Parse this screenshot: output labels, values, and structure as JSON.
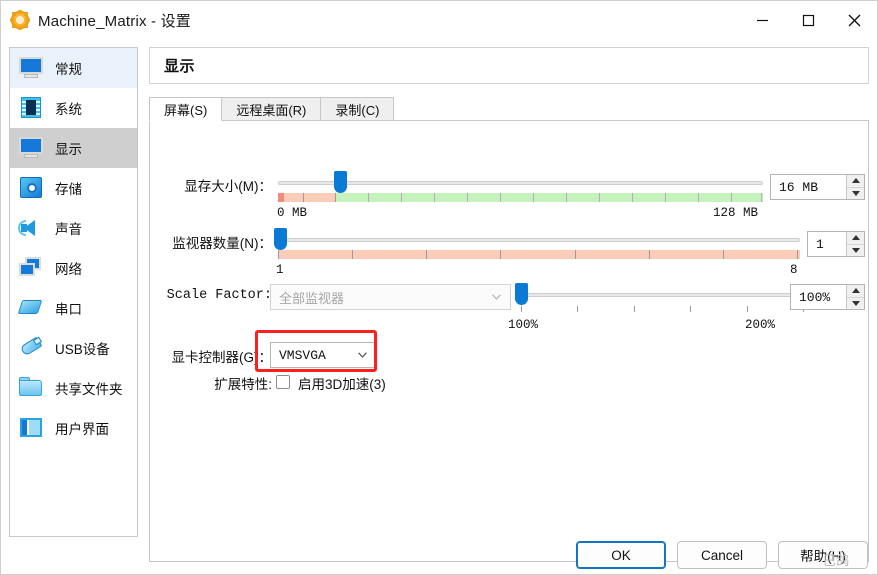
{
  "window": {
    "title": "Machine_Matrix - 设置",
    "app_icon": "vbox-settings-icon",
    "minimize": "—",
    "maximize": "□",
    "close": "✕"
  },
  "sidebar": {
    "items": [
      {
        "label": "常规",
        "icon": "monitor-general-icon",
        "state": "hover"
      },
      {
        "label": "系统",
        "icon": "chip-system-icon",
        "state": "normal"
      },
      {
        "label": "显示",
        "icon": "monitor-display-icon",
        "state": "selected"
      },
      {
        "label": "存储",
        "icon": "harddisk-storage-icon",
        "state": "normal"
      },
      {
        "label": "声音",
        "icon": "speaker-audio-icon",
        "state": "normal"
      },
      {
        "label": "网络",
        "icon": "network-icon",
        "state": "normal"
      },
      {
        "label": "串口",
        "icon": "serial-port-icon",
        "state": "normal"
      },
      {
        "label": "USB设备",
        "icon": "usb-device-icon",
        "state": "normal"
      },
      {
        "label": "共享文件夹",
        "icon": "shared-folder-icon",
        "state": "normal"
      },
      {
        "label": "用户界面",
        "icon": "user-interface-icon",
        "state": "normal"
      }
    ]
  },
  "pane": {
    "title": "显示",
    "tabs": [
      {
        "label": "屏幕(S)",
        "active": true
      },
      {
        "label": "远程桌面(R)",
        "active": false
      },
      {
        "label": "录制(C)",
        "active": false
      }
    ]
  },
  "form": {
    "video_memory": {
      "label": "显存大小(M)：",
      "value": "16 MB",
      "min_label": "0 MB",
      "max_label": "128 MB"
    },
    "monitor_count": {
      "label": "监视器数量(N)：",
      "value": "1",
      "min_label": "1",
      "max_label": "8"
    },
    "scale_factor": {
      "label": "Scale Factor:",
      "monitor_select": "全部监视器",
      "value": "100%",
      "min_label": "100%",
      "max_label": "200%"
    },
    "graphics_controller": {
      "label": "显卡控制器(G)：",
      "value": "VMSVGA",
      "highlighted": true,
      "highlight_color": "#ff1f1f"
    },
    "extended_features": {
      "label": "扩展特性:",
      "checkbox_label": "启用3D加速(3)",
      "checked": false
    }
  },
  "footer": {
    "ok": "OK",
    "cancel": "Cancel",
    "help": "帮助(H)",
    "watermark": "巴鸽"
  }
}
